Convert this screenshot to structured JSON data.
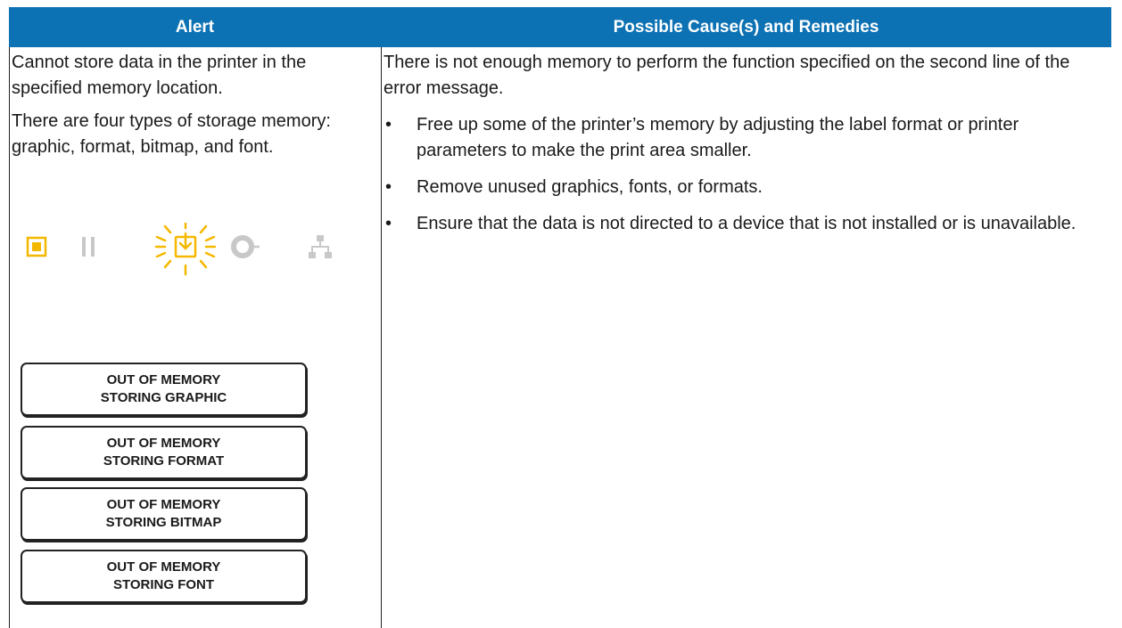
{
  "header": {
    "col1": "Alert",
    "col2": "Possible Cause(s) and Remedies"
  },
  "alert": {
    "para1": "Cannot store data in the printer in the specified memory location.",
    "para2": "There are four types of storage memory: graphic, format, bitmap, and font.",
    "icons": [
      "status-icon",
      "pause-icon",
      "data-icon-flashing",
      "supplies-icon",
      "network-icon"
    ],
    "lcd_messages": [
      {
        "line1": "OUT OF MEMORY",
        "line2": "STORING GRAPHIC"
      },
      {
        "line1": "OUT OF MEMORY",
        "line2": "STORING FORMAT"
      },
      {
        "line1": "OUT OF MEMORY",
        "line2": "STORING BITMAP"
      },
      {
        "line1": "OUT OF MEMORY",
        "line2": "STORING FONT"
      }
    ]
  },
  "remedies": {
    "intro": "There is not enough memory to perform the function specified on the second line of the error message.",
    "bullet_char": "•",
    "items": [
      "Free up some of the printer’s memory by adjusting the label format or printer parameters to make the print area smaller.",
      "Remove unused graphics, fonts, or formats.",
      "Ensure that the data is not directed to a device that is not installed or is unavailable."
    ]
  },
  "colors": {
    "header_bg": "#0d72b3",
    "header_text": "#ffffff",
    "active_icon": "#f5b800",
    "inactive_icon": "#c8c8c8"
  }
}
